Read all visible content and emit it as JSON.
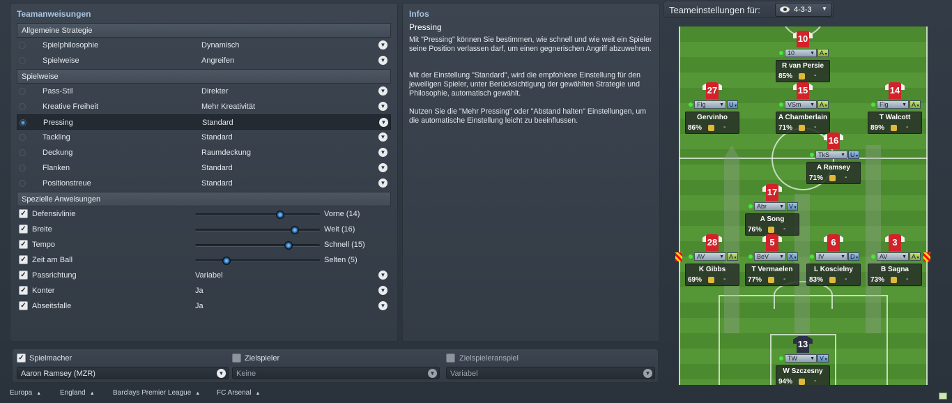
{
  "left_panel": {
    "title": "Teamanweisungen",
    "sections": {
      "strategy": "Allgemeine Strategie",
      "style": "Spielweise",
      "special": "Spezielle Anweisungen"
    },
    "strategy_rows": [
      {
        "label": "Spielphilosophie",
        "value": "Dynamisch"
      },
      {
        "label": "Spielweise",
        "value": "Angreifen"
      }
    ],
    "style_rows": [
      {
        "label": "Pass-Stil",
        "value": "Direkter"
      },
      {
        "label": "Kreative Freiheit",
        "value": "Mehr Kreativität"
      },
      {
        "label": "Pressing",
        "value": "Standard",
        "selected": true
      },
      {
        "label": "Tackling",
        "value": "Standard"
      },
      {
        "label": "Deckung",
        "value": "Raumdeckung"
      },
      {
        "label": "Flanken",
        "value": "Standard"
      },
      {
        "label": "Positionstreue",
        "value": "Standard"
      }
    ],
    "special_rows": [
      {
        "label": "Defensivlinie",
        "value": "Vorne (14)",
        "checked": true,
        "level": 0.68
      },
      {
        "label": "Breite",
        "value": "Weit (16)",
        "checked": true,
        "level": 0.8
      },
      {
        "label": "Tempo",
        "value": "Schnell (15)",
        "checked": true,
        "level": 0.75
      },
      {
        "label": "Zeit am Ball",
        "value": "Selten (5)",
        "checked": true,
        "level": 0.25
      },
      {
        "label": "Passrichtung",
        "value": "Variabel",
        "checked": true
      },
      {
        "label": "Konter",
        "value": "Ja",
        "checked": true
      },
      {
        "label": "Abseitsfalle",
        "value": "Ja",
        "checked": true
      }
    ]
  },
  "info_panel": {
    "title": "Infos",
    "heading": "Pressing",
    "p1": "Mit \"Pressing\" können Sie bestimmen, wie schnell und wie weit ein Spieler seine Position verlassen darf, um einen gegnerischen Angriff abzuwehren.",
    "p2": "Mit der Einstellung \"Standard\", wird die empfohlene Einstellung für den jeweiligen Spieler, unter Berücksichtigung der gewählten Strategie und Philosophie, automatisch gewählt.",
    "p3": "Nutzen Sie die \"Mehr Pressing\" oder \"Abstand halten\" Einstellungen, um die automatische Einstellung leicht zu beeinflussen."
  },
  "bottom": {
    "playmaker": {
      "label": "Spielmacher",
      "checked": true,
      "value": "Aaron Ramsey (MZR)"
    },
    "target": {
      "label": "Zielspieler",
      "checked": false,
      "value": "Keine"
    },
    "target_pass": {
      "label": "Zielspieleranspiel",
      "checked": false,
      "value": "Variabel"
    }
  },
  "team_settings": {
    "label": "Teameinstellungen für:",
    "formation": "4-3-3",
    "eye_icon": "eye-icon"
  },
  "players": [
    {
      "number": "10",
      "role": "10",
      "duty": "A",
      "name": "R van Persie",
      "pct": "85%"
    },
    {
      "number": "27",
      "role": "Flg",
      "duty": "U",
      "name": "Gervinho",
      "pct": "86%"
    },
    {
      "number": "15",
      "role": "VSm",
      "duty": "A",
      "name": "A Chamberlain",
      "pct": "71%"
    },
    {
      "number": "14",
      "role": "Flg",
      "duty": "A",
      "name": "T Walcott",
      "pct": "89%"
    },
    {
      "number": "16",
      "role": "TkS",
      "duty": "U",
      "name": "A Ramsey",
      "pct": "71%"
    },
    {
      "number": "17",
      "role": "Abr",
      "duty": "V",
      "name": "A Song",
      "pct": "76%"
    },
    {
      "number": "28",
      "role": "AV",
      "duty": "A",
      "name": "K Gibbs",
      "pct": "69%"
    },
    {
      "number": "5",
      "role": "BeV",
      "duty": "X",
      "name": "T Vermaelen",
      "pct": "77%"
    },
    {
      "number": "6",
      "role": "IV",
      "duty": "D",
      "name": "L Koscielny",
      "pct": "83%"
    },
    {
      "number": "3",
      "role": "AV",
      "duty": "A",
      "name": "B Sagna",
      "pct": "73%"
    },
    {
      "number": "13",
      "role": "TW",
      "duty": "V",
      "name": "W Szczesny",
      "pct": "94%"
    }
  ],
  "card_dash": "-",
  "footer": [
    "Europa",
    "England",
    "Barclays Premier League",
    "FC Arsenal"
  ]
}
